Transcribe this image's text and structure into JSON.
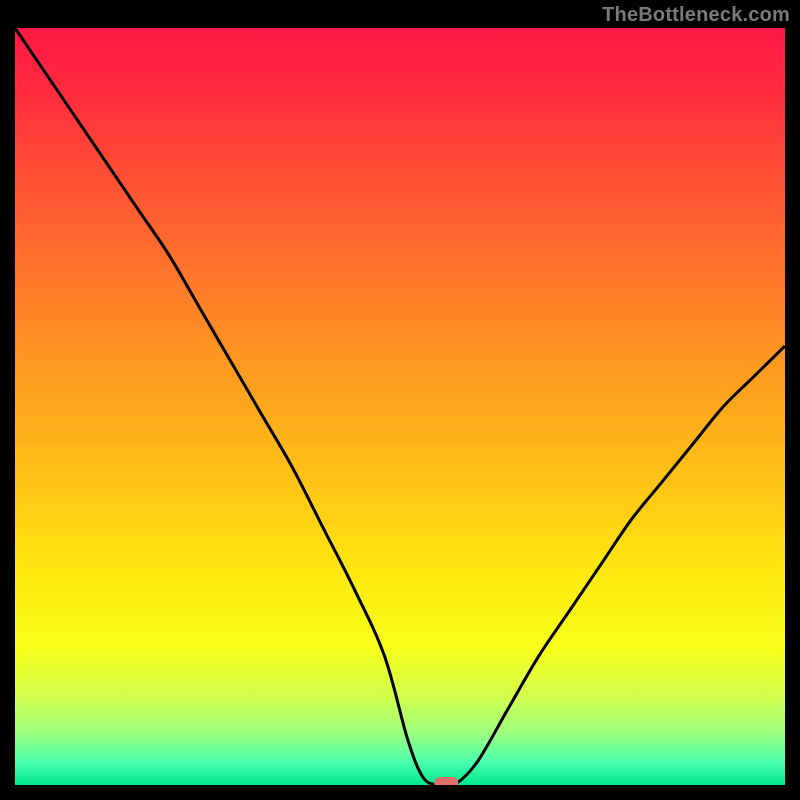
{
  "attribution": "TheBottleneck.com",
  "chart_data": {
    "type": "line",
    "title": "",
    "xlabel": "",
    "ylabel": "",
    "xlim": [
      0,
      100
    ],
    "ylim": [
      0,
      100
    ],
    "series": [
      {
        "name": "curve",
        "x": [
          0,
          4,
          8,
          12,
          16,
          20,
          24,
          28,
          32,
          36,
          40,
          44,
          48,
          51,
          53,
          55,
          57,
          60,
          64,
          68,
          72,
          76,
          80,
          84,
          88,
          92,
          96,
          100
        ],
        "y": [
          100,
          94,
          88,
          82,
          76,
          70,
          63,
          56,
          49,
          42,
          34,
          26,
          17,
          6,
          1,
          0,
          0,
          3,
          10,
          17,
          23,
          29,
          35,
          40,
          45,
          50,
          54,
          58
        ]
      }
    ],
    "marker": {
      "x": 56,
      "y": 0,
      "color": "#e36f6a"
    },
    "gradient_stops": [
      {
        "offset": 0.0,
        "color": "#ff1745"
      },
      {
        "offset": 0.08,
        "color": "#ff2a3f"
      },
      {
        "offset": 0.18,
        "color": "#ff4a35"
      },
      {
        "offset": 0.3,
        "color": "#ff6e2d"
      },
      {
        "offset": 0.45,
        "color": "#ff9a20"
      },
      {
        "offset": 0.6,
        "color": "#ffc316"
      },
      {
        "offset": 0.72,
        "color": "#ffe80f"
      },
      {
        "offset": 0.82,
        "color": "#f6ff1a"
      },
      {
        "offset": 0.88,
        "color": "#d4ff4a"
      },
      {
        "offset": 0.93,
        "color": "#9fff7c"
      },
      {
        "offset": 0.97,
        "color": "#4affae"
      },
      {
        "offset": 1.0,
        "color": "#00e98b"
      }
    ]
  }
}
